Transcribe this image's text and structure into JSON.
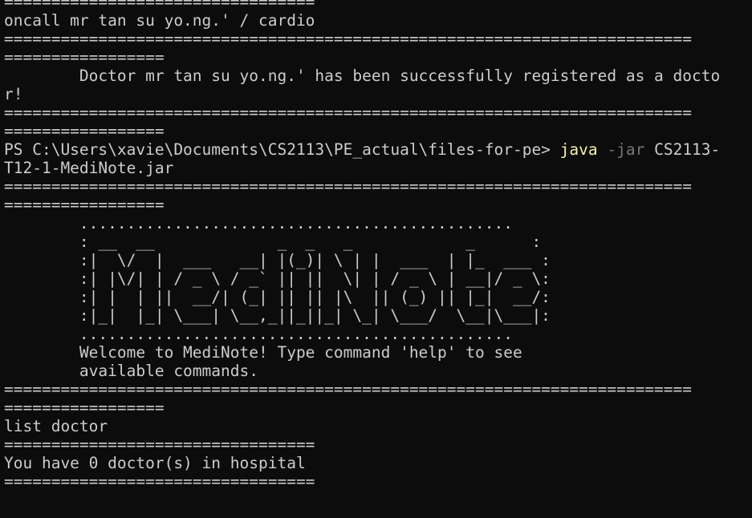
{
  "terminal": {
    "lines": [
      "=================================",
      "oncall mr tan su yo.ng.' / cardio",
      "=========================================================================",
      "=================",
      "        Doctor mr tan su yo.ng.' has been successfully registered as a docto",
      "r!",
      "=========================================================================",
      "=================",
      "",
      "=========================================================================",
      "=================",
      "        ..............................................",
      "        : __  __             _  _   _            _      :",
      "        :|  \\/  |  ___   __| |(_)| \\ | |  ___  | |_  ___ :",
      "        :| |\\/| | / _ \\ / _` || ||  \\| | / _ \\ | __|/ _ \\:",
      "        :| |  | ||  __/| (_| || || |\\  || (_) || |_|  __/:",
      "        :|_|  |_| \\___| \\__,_||_||_| \\_| \\___/  \\__|\\___|:",
      "        ..............................................",
      "        Welcome to MediNote! Type command 'help' to see",
      "        available commands.",
      "=========================================================================",
      "=================",
      "list doctor",
      "=================================",
      "You have 0 doctor(s) in hospital",
      "================================="
    ],
    "prompt": {
      "path": "PS C:\\Users\\xavie\\Documents\\CS2113\\PE_actual\\files-for-pe> ",
      "java": "java",
      "flag": "-jar",
      "arg1": " CS2113-",
      "arg2": "T12-1-MediNote.jar"
    }
  }
}
